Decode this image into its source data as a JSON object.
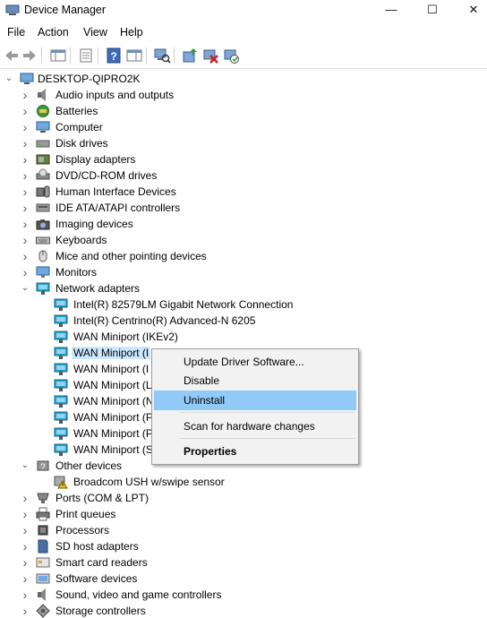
{
  "window": {
    "title": "Device Manager",
    "controls": {
      "minimize": "—",
      "maximize": "☐",
      "close": "✕"
    }
  },
  "menubar": [
    "File",
    "Action",
    "View",
    "Help"
  ],
  "toolbar": [
    "back-icon",
    "forward-icon",
    "show-hide-console-tree-icon",
    "properties-icon",
    "help-icon",
    "action-pane-icon",
    "scan-hardware-icon",
    "update-driver-icon",
    "uninstall-icon",
    "enable-device-icon"
  ],
  "tree": {
    "root": "DESKTOP-QIPRO2K",
    "items": [
      {
        "label": "Audio inputs and outputs",
        "icon": "speaker-icon",
        "level": 1,
        "expanded": false
      },
      {
        "label": "Batteries",
        "icon": "battery-icon",
        "level": 1,
        "expanded": false
      },
      {
        "label": "Computer",
        "icon": "computer-icon",
        "level": 1,
        "expanded": false
      },
      {
        "label": "Disk drives",
        "icon": "disk-drive-icon",
        "level": 1,
        "expanded": false
      },
      {
        "label": "Display adapters",
        "icon": "display-adapter-icon",
        "level": 1,
        "expanded": false
      },
      {
        "label": "DVD/CD-ROM drives",
        "icon": "dvd-icon",
        "level": 1,
        "expanded": false
      },
      {
        "label": "Human Interface Devices",
        "icon": "hid-icon",
        "level": 1,
        "expanded": false
      },
      {
        "label": "IDE ATA/ATAPI controllers",
        "icon": "ide-controller-icon",
        "level": 1,
        "expanded": false
      },
      {
        "label": "Imaging devices",
        "icon": "camera-icon",
        "level": 1,
        "expanded": false
      },
      {
        "label": "Keyboards",
        "icon": "keyboard-icon",
        "level": 1,
        "expanded": false
      },
      {
        "label": "Mice and other pointing devices",
        "icon": "mouse-icon",
        "level": 1,
        "expanded": false
      },
      {
        "label": "Monitors",
        "icon": "monitor-icon",
        "level": 1,
        "expanded": false
      },
      {
        "label": "Network adapters",
        "icon": "network-adapter-icon",
        "level": 1,
        "expanded": true
      },
      {
        "label": "Intel(R) 82579LM Gigabit Network Connection",
        "icon": "network-adapter-icon",
        "level": 2
      },
      {
        "label": "Intel(R) Centrino(R) Advanced-N 6205",
        "icon": "network-adapter-icon",
        "level": 2
      },
      {
        "label": "WAN Miniport (IKEv2)",
        "icon": "network-adapter-icon",
        "level": 2
      },
      {
        "label": "WAN Miniport (I",
        "icon": "network-adapter-icon",
        "level": 2,
        "selected": true
      },
      {
        "label": "WAN Miniport (I",
        "icon": "network-adapter-icon",
        "level": 2
      },
      {
        "label": "WAN Miniport (L",
        "icon": "network-adapter-icon",
        "level": 2
      },
      {
        "label": "WAN Miniport (N",
        "icon": "network-adapter-icon",
        "level": 2
      },
      {
        "label": "WAN Miniport (P",
        "icon": "network-adapter-icon",
        "level": 2
      },
      {
        "label": "WAN Miniport (P",
        "icon": "network-adapter-icon",
        "level": 2
      },
      {
        "label": "WAN Miniport (S",
        "icon": "network-adapter-icon",
        "level": 2
      },
      {
        "label": "Other devices",
        "icon": "other-devices-icon",
        "level": 1,
        "expanded": true
      },
      {
        "label": "Broadcom USH w/swipe sensor",
        "icon": "warning-device-icon",
        "level": 2
      },
      {
        "label": "Ports (COM & LPT)",
        "icon": "port-icon",
        "level": 1,
        "expanded": false
      },
      {
        "label": "Print queues",
        "icon": "printer-icon",
        "level": 1,
        "expanded": false
      },
      {
        "label": "Processors",
        "icon": "processor-icon",
        "level": 1,
        "expanded": false
      },
      {
        "label": "SD host adapters",
        "icon": "sd-card-icon",
        "level": 1,
        "expanded": false
      },
      {
        "label": "Smart card readers",
        "icon": "smart-card-icon",
        "level": 1,
        "expanded": false
      },
      {
        "label": "Software devices",
        "icon": "software-device-icon",
        "level": 1,
        "expanded": false
      },
      {
        "label": "Sound, video and game controllers",
        "icon": "speaker-icon",
        "level": 1,
        "expanded": false
      },
      {
        "label": "Storage controllers",
        "icon": "storage-controller-icon",
        "level": 1,
        "expanded": false
      }
    ]
  },
  "context_menu": {
    "items": [
      {
        "label": "Update Driver Software...",
        "hover": false,
        "bold": false
      },
      {
        "label": "Disable",
        "hover": false,
        "bold": false
      },
      {
        "label": "Uninstall",
        "hover": true,
        "bold": false
      },
      {
        "label": "Scan for hardware changes",
        "hover": false,
        "bold": false
      },
      {
        "label": "Properties",
        "hover": false,
        "bold": true
      }
    ]
  },
  "colors": {
    "selection": "#cce8ff",
    "menu_hover": "#91c9f7",
    "menu_bg": "#f2f2f2",
    "icon_blue": "#2b7fd0",
    "icon_teal": "#26a0c8"
  }
}
